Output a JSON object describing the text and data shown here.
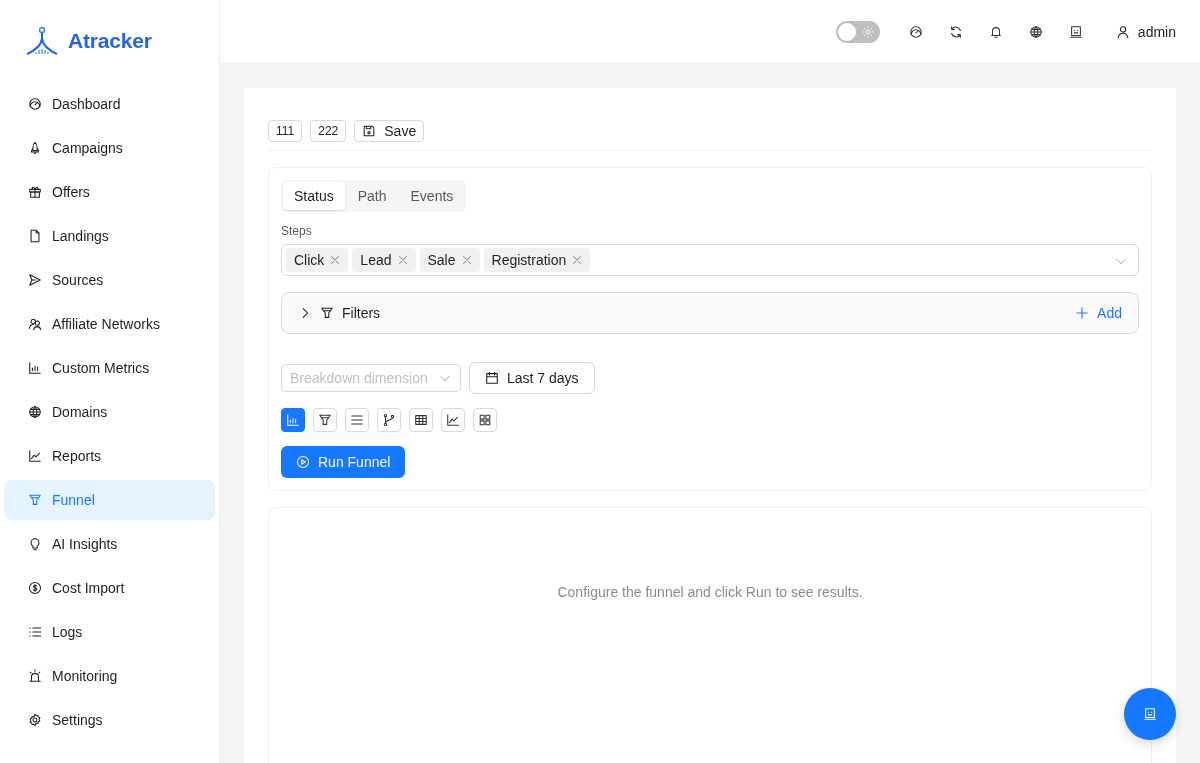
{
  "brand": "Atracker",
  "sidebar": {
    "items": [
      {
        "label": "Dashboard",
        "selected": false
      },
      {
        "label": "Campaigns",
        "selected": false
      },
      {
        "label": "Offers",
        "selected": false
      },
      {
        "label": "Landings",
        "selected": false
      },
      {
        "label": "Sources",
        "selected": false
      },
      {
        "label": "Affiliate Networks",
        "selected": false
      },
      {
        "label": "Custom Metrics",
        "selected": false
      },
      {
        "label": "Domains",
        "selected": false
      },
      {
        "label": "Reports",
        "selected": false
      },
      {
        "label": "Funnel",
        "selected": true
      },
      {
        "label": "AI Insights",
        "selected": false
      },
      {
        "label": "Cost Import",
        "selected": false
      },
      {
        "label": "Logs",
        "selected": false
      },
      {
        "label": "Monitoring",
        "selected": false
      },
      {
        "label": "Settings",
        "selected": false
      }
    ]
  },
  "header": {
    "theme_toggle": {
      "on": false
    },
    "user": "admin"
  },
  "toolbar": [
    {
      "label": "111",
      "kind": "plain"
    },
    {
      "label": "222",
      "kind": "plain"
    },
    {
      "label": "Save",
      "kind": "save"
    }
  ],
  "tabs": [
    {
      "label": "Status",
      "selected": true
    },
    {
      "label": "Path",
      "selected": false
    },
    {
      "label": "Events",
      "selected": false
    }
  ],
  "steps": {
    "label": "Steps",
    "tags": [
      "Click",
      "Lead",
      "Sale",
      "Registration"
    ]
  },
  "filters": {
    "label": "Filters",
    "expanded": false,
    "add": "Add"
  },
  "breakdown": {
    "placeholder": "Breakdown dimension"
  },
  "date_range": "Last 7 days",
  "view_modes": [
    {
      "selected": true
    },
    {
      "selected": false
    },
    {
      "selected": false
    },
    {
      "selected": false
    },
    {
      "selected": false
    },
    {
      "selected": false
    },
    {
      "selected": false
    }
  ],
  "run_button": "Run Funnel",
  "results": {
    "message": "Configure the funnel and click Run to see results."
  }
}
